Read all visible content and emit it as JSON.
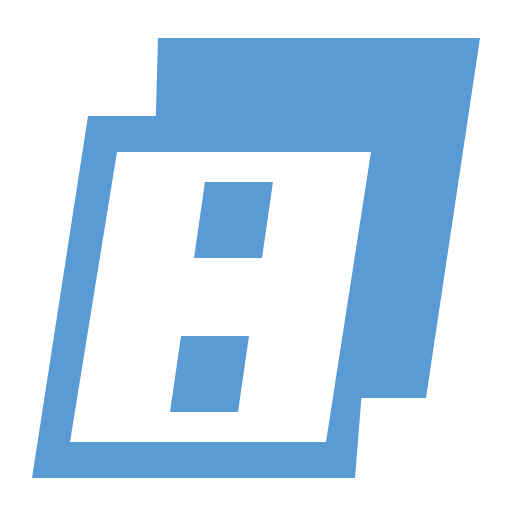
{
  "icon": {
    "name": "app-logo-icon",
    "colors": {
      "primary": "#5B9BD5",
      "background": "#FFFFFF"
    }
  }
}
